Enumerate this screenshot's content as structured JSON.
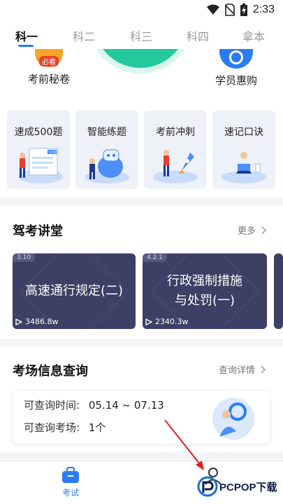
{
  "status_bar": {
    "time": "2:33",
    "icons": [
      "wifi-icon",
      "no-sim-icon",
      "battery-charging-icon"
    ]
  },
  "tabs": [
    {
      "label": "科一",
      "active": true
    },
    {
      "label": "科二",
      "active": false
    },
    {
      "label": "科三",
      "active": false
    },
    {
      "label": "科四",
      "active": false
    },
    {
      "label": "拿本",
      "active": false
    }
  ],
  "quick_entries": {
    "left": {
      "label": "考前秘卷",
      "badge": "必看"
    },
    "right": {
      "label": "学员惠购"
    }
  },
  "feature_cards": [
    {
      "label": "速成500题",
      "art_text": "500题"
    },
    {
      "label": "智能练题"
    },
    {
      "label": "考前冲刺"
    },
    {
      "label": "速记口诀"
    }
  ],
  "lecture": {
    "title": "驾考讲堂",
    "more": "更多",
    "videos": [
      {
        "tag": "3.10",
        "title_lines": [
          "高速通行规定(二)"
        ],
        "views": "3486.8w"
      },
      {
        "tag": "4.2.1",
        "title_lines": [
          "行政强制措施",
          "与处罚(一)"
        ],
        "views": "2340.3w"
      }
    ]
  },
  "venue": {
    "title": "考场信息查询",
    "more": "查询详情",
    "rows": [
      {
        "label": "可查询时间:",
        "value": "05.14 ~ 07.13"
      },
      {
        "label": "可查询考场:",
        "value": "1个"
      }
    ]
  },
  "bottom_nav": {
    "exam_label": "考试"
  },
  "watermark": {
    "text": "PCPOP下载"
  },
  "colors": {
    "accent": "#2a7cf6",
    "hero": "#23c89d",
    "video_bg": "#3c4064",
    "arrow": "#e02020"
  }
}
